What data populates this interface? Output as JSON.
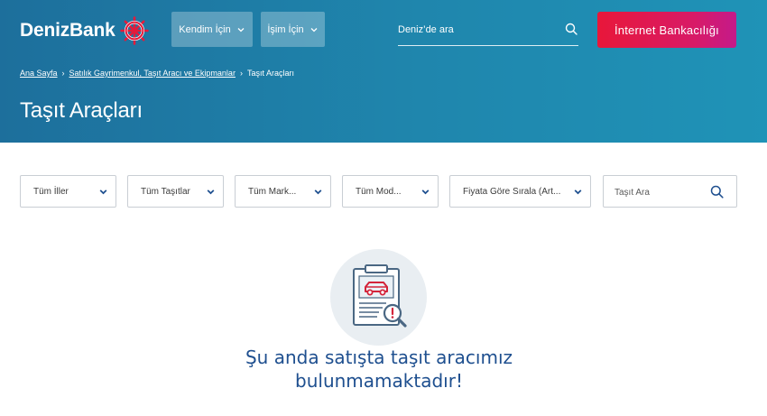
{
  "header": {
    "logo_text": "DenizBank",
    "logo_icon": "ship-wheel-icon",
    "nav": [
      {
        "label": "Kendim İçin"
      },
      {
        "label": "İşim İçin"
      }
    ],
    "search_placeholder": "Deniz’de ara",
    "internet_banking_label": "İnternet Bankacılığı"
  },
  "breadcrumb": [
    {
      "label": "Ana Sayfa"
    },
    {
      "label": "Satılık Gayrimenkul, Taşıt Aracı ve Ekipmanlar"
    },
    {
      "label": "Taşıt Araçları"
    }
  ],
  "page_title": "Taşıt Araçları",
  "filters": [
    {
      "label": "Tüm İller"
    },
    {
      "label": "Tüm Taşıtlar"
    },
    {
      "label": "Tüm Mark..."
    },
    {
      "label": "Tüm Mod..."
    },
    {
      "label": "Fiyata Göre Sırala (Art..."
    }
  ],
  "filter_search_placeholder": "Taşıt Ara",
  "empty_state": {
    "icon": "clipboard-car-search-icon",
    "message_line1": "Şu anda satışta taşıt aracımız",
    "message_line2": "bulunmamaktadır!"
  },
  "colors": {
    "header_blue": "#1d7aa6",
    "cta_red": "#e8173a",
    "cta_magenta": "#c41a8a",
    "message_blue": "#1e4f8f",
    "chevron_blue": "#1e4f8f"
  }
}
